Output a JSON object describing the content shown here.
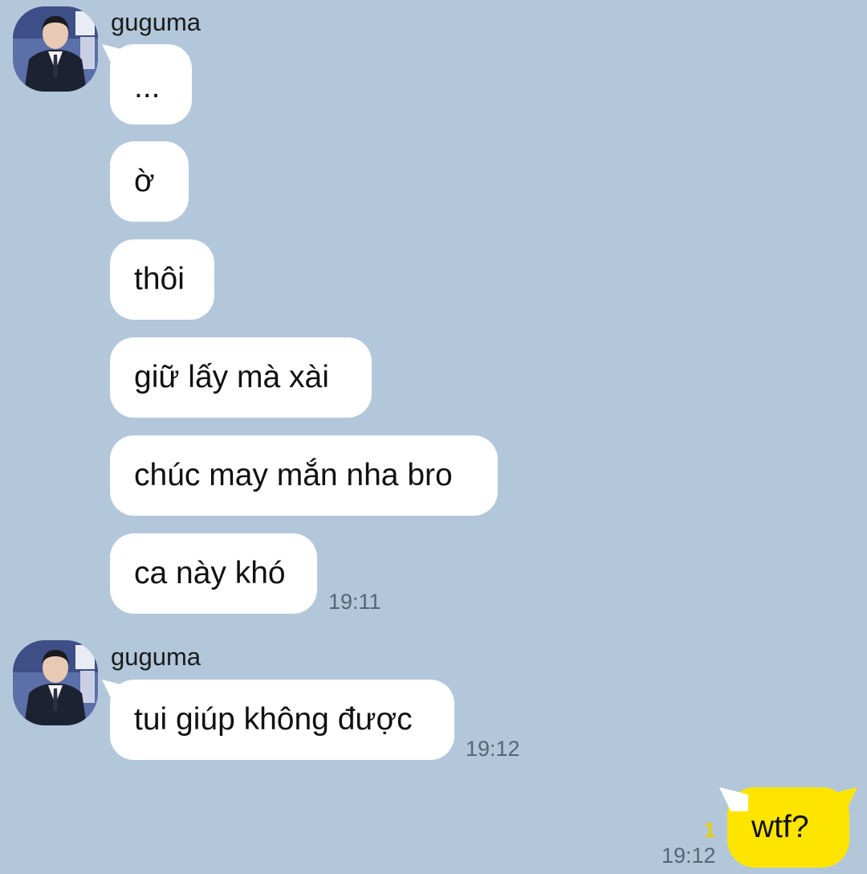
{
  "chat": {
    "groups": [
      {
        "sender": "guguma",
        "messages": [
          "...",
          "ờ",
          "thôi",
          "giữ lấy mà xài",
          "chúc may mắn nha bro",
          "ca này khó"
        ],
        "time": "19:11"
      },
      {
        "sender": "guguma",
        "messages": [
          "tui giúp không được"
        ],
        "time": "19:12"
      }
    ],
    "mine": {
      "message": "wtf?",
      "unread_count": "1",
      "time": "19:12"
    }
  },
  "colors": {
    "background": "#b2c7da",
    "incoming_bubble": "#ffffff",
    "outgoing_bubble": "#fee500",
    "unread_marker": "#e6d000"
  },
  "icons": {
    "avatar": "profile-photo-man-in-suit"
  }
}
